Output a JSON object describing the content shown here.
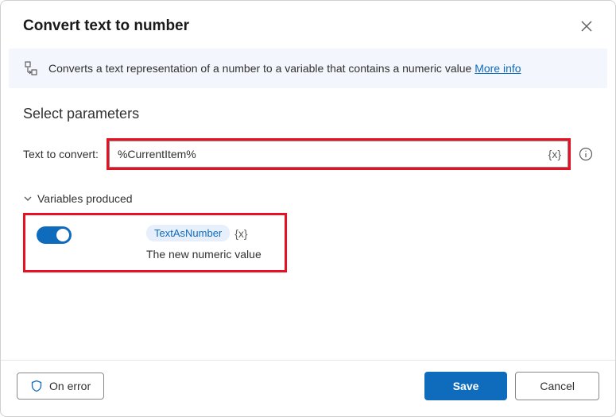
{
  "dialog": {
    "title": "Convert text to number"
  },
  "banner": {
    "text": "Converts a text representation of a number to a variable that contains a numeric value ",
    "more_info": "More info"
  },
  "section": {
    "title": "Select parameters"
  },
  "field": {
    "label": "Text to convert:",
    "value": "%CurrentItem%",
    "var_icon": "{x}"
  },
  "variables_produced": {
    "header": "Variables produced",
    "variable_name": "TextAsNumber",
    "var_icon": "{x}",
    "description": "The new numeric value"
  },
  "footer": {
    "on_error": "On error",
    "save": "Save",
    "cancel": "Cancel"
  }
}
